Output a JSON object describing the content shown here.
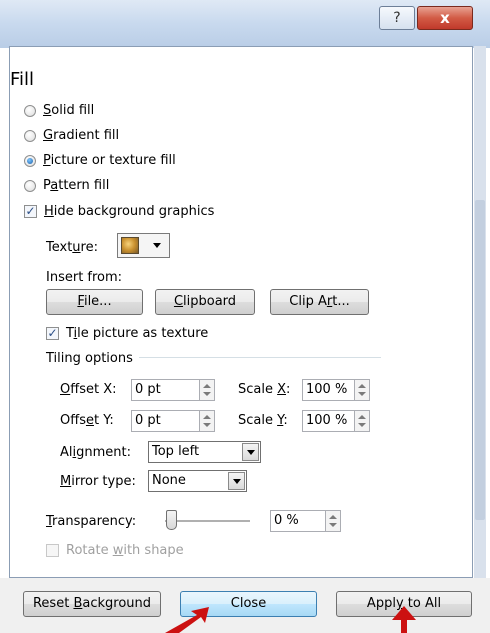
{
  "window": {
    "help_glyph": "?",
    "close_glyph": "x"
  },
  "section": {
    "heading": "Fill"
  },
  "fill_options": [
    {
      "label": "Solid fill",
      "selected": false
    },
    {
      "label": "Gradient fill",
      "selected": false
    },
    {
      "label": "Picture or texture fill",
      "selected": true
    },
    {
      "label": "Pattern fill",
      "selected": false
    }
  ],
  "hide_background": {
    "label": "Hide background graphics",
    "checked": true
  },
  "texture": {
    "label": "Texture:",
    "icon": "texture-swatch-icon"
  },
  "insert_from": {
    "label": "Insert from:",
    "buttons": [
      "File...",
      "Clipboard",
      "Clip Art..."
    ]
  },
  "tile": {
    "label": "Tile picture as texture",
    "checked": true
  },
  "tiling_options": {
    "label": "Tiling options",
    "offset_x": {
      "label": "Offset X:",
      "value": "0 pt"
    },
    "offset_y": {
      "label": "Offset Y:",
      "value": "0 pt"
    },
    "scale_x": {
      "label": "Scale X:",
      "value": "100 %"
    },
    "scale_y": {
      "label": "Scale Y:",
      "value": "100 %"
    },
    "alignment": {
      "label": "Alignment:",
      "value": "Top left"
    },
    "mirror": {
      "label": "Mirror type:",
      "value": "None"
    }
  },
  "transparency": {
    "label": "Transparency:",
    "value": "0 %",
    "level": 0
  },
  "rotate": {
    "label": "Rotate with shape",
    "checked": false,
    "enabled": false
  },
  "footer": {
    "reset_label": "Reset Background",
    "close_label": "Close",
    "apply_label": "Apply to All"
  },
  "colors": {
    "pointer": "#cc1111",
    "focus_border": "#3c7fb1"
  }
}
